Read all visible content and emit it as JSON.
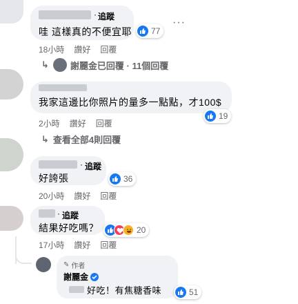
{
  "comments": [
    {
      "follow": "追蹤",
      "text": "哇 這樣真的不便宜耶",
      "reactions": "77",
      "time": "18小時",
      "like": "讚好",
      "reply": "回覆",
      "replies_summary": "謝麗金已回覆 · 11個回覆"
    },
    {
      "text": "我家這邊比你照片的量多一點點，才100$",
      "reactions": "19",
      "time": "2小時",
      "like": "讚好",
      "reply": "回覆",
      "replies_summary": "查看全部4則回覆"
    },
    {
      "follow": "追蹤",
      "text": "好誇張",
      "reactions": "36",
      "time": "20小時",
      "like": "讚好",
      "reply": "回覆"
    },
    {
      "follow": "追蹤",
      "text": "結果好吃嗎？",
      "reactions": "20",
      "time": "17小時",
      "like": "讚好",
      "reply": "回覆"
    }
  ],
  "author_reply": {
    "badge": "作者",
    "name": "謝麗金",
    "text": "好吃！有焦糖香味",
    "reactions": "51"
  },
  "colors": {
    "like": "#1877f2",
    "love": "#f33e58",
    "haha": "#f7b125",
    "bubble": "#f0f2f5",
    "meta": "#65676b"
  },
  "icons": [
    "like-icon",
    "love-icon",
    "haha-icon",
    "reply-arrow-icon",
    "more-icon",
    "pencil-icon",
    "verified-icon"
  ]
}
